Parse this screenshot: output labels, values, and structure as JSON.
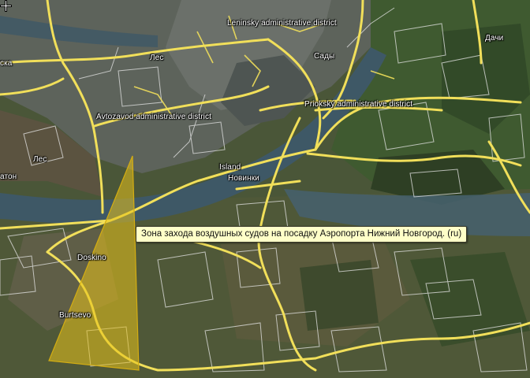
{
  "map": {
    "labels": {
      "leninsky": "Leninsky administrative district",
      "sady": "Сады",
      "les_top": "Лес",
      "ska": "ска",
      "dachi": "Дачи",
      "priokskiy": "Priokský administrative district",
      "avtozavod": "Avtozavod administrative district",
      "les_left": "Лес",
      "aton": "атон",
      "island": "Island",
      "novinki": "Новинки",
      "doskino": "Doskino",
      "burtsevo": "Burtsevo"
    },
    "tooltip": {
      "text": "Зона захода воздушных судов на посадку Аэропорта Нижний Новгород. (ru)"
    },
    "colors": {
      "road": "#f1df5a",
      "river": "#3e5866",
      "highlight_polygon": "#e8c21a",
      "tooltip_bg": "#ffffc8"
    }
  }
}
